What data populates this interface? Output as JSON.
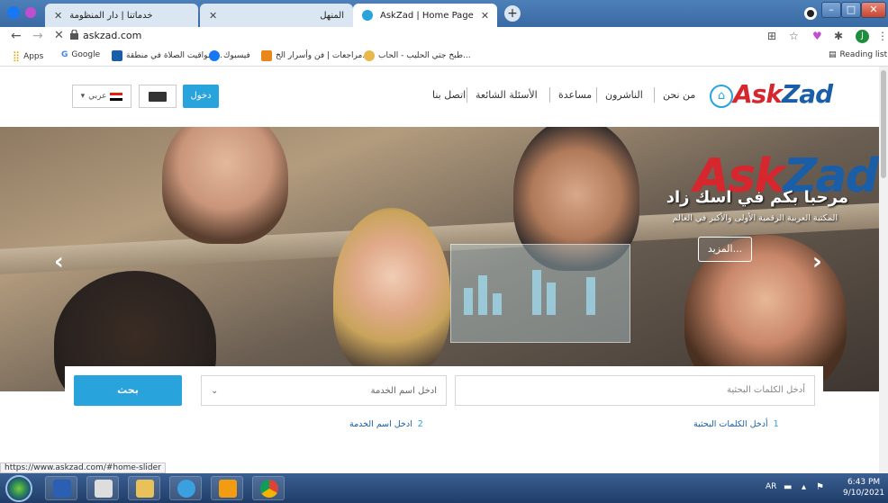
{
  "browser": {
    "tabs": [
      {
        "label": "خدماتنا | دار المنظومة",
        "active": false
      },
      {
        "label": "المنهل",
        "active": false
      },
      {
        "label": "AskZad | Home Page",
        "active": true
      }
    ],
    "new_tab": "+",
    "address": "askzad.com",
    "bookmarks": {
      "apps": "Apps",
      "google": "Google",
      "b1": "مواقيت الصلاة في منطقة ...",
      "b2": "فيسبوك",
      "b3": "مراجعات | فن وأسرار الخ...",
      "b4": "طبخ جتي الحليب - الحاب...",
      "reading_list": "Reading list"
    },
    "profile_initial": "J"
  },
  "site": {
    "logo_ask": "Ask",
    "logo_zad": "Zad",
    "nav": [
      "من نحن",
      "الناشرون",
      "مساعدة",
      "الأسئلة الشائعة",
      "اتصل بنا"
    ],
    "login": "دخول",
    "language": "عربي"
  },
  "hero": {
    "brand_ask": "Ask",
    "brand_zad": "Zad",
    "title": "مرحبا بكم في اسك زاد",
    "subtitle": "المكتبة العربية الرقمية الأولى والأكبر في العالم",
    "more": "المزيد...",
    "prev": "‹",
    "next": "›"
  },
  "search": {
    "keywords_placeholder": "أدخل الكلمات البحثية",
    "service_placeholder": "ادخل اسم الخدمة",
    "search_button": "بحث",
    "step1_num": "1",
    "step1_text": "أدخل الكلمات البحثية",
    "step2_num": "2",
    "step2_text": "ادخل اسم الخدمة"
  },
  "status_url": "https://www.askzad.com/#home-slider",
  "taskbar": {
    "lang": "AR",
    "time": "6:43 PM",
    "date": "9/10/2021"
  }
}
